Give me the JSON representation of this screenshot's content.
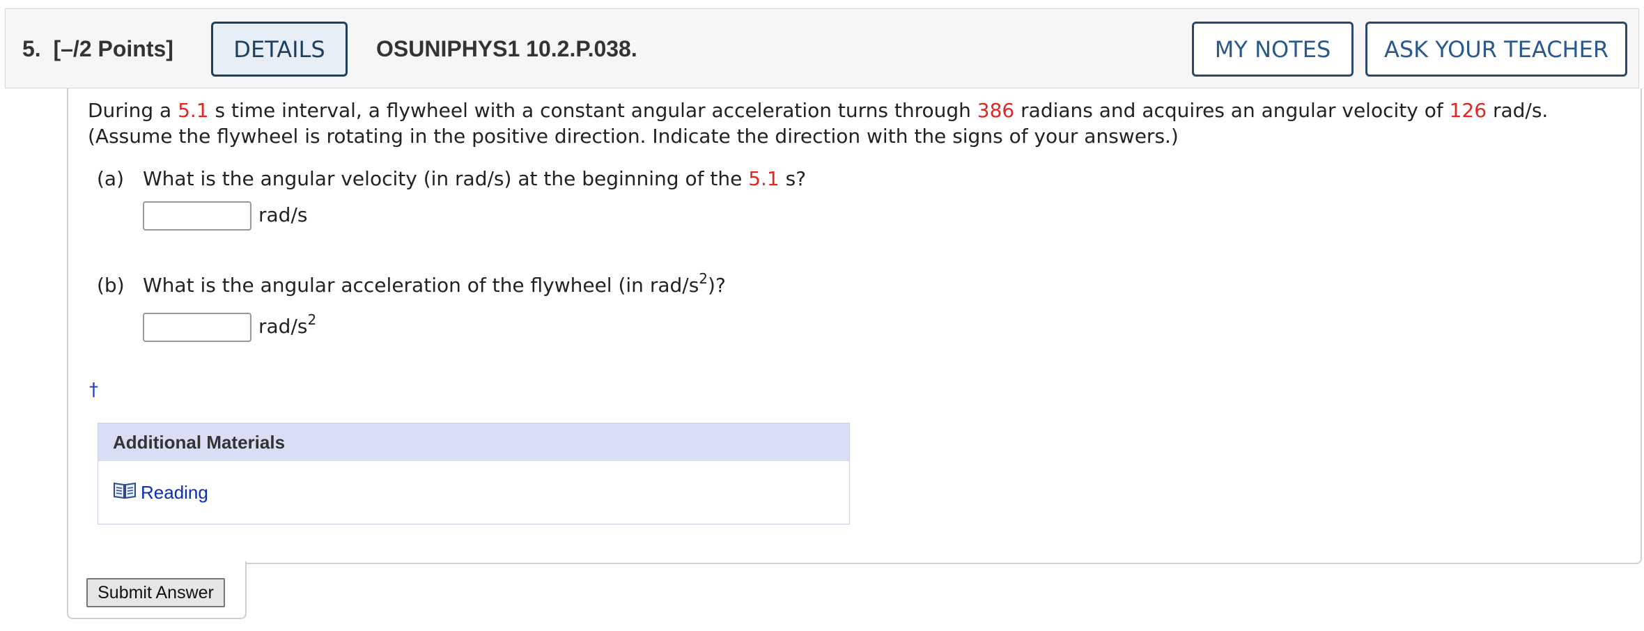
{
  "header": {
    "question_number": "5.",
    "points": "[–/2 Points]",
    "details_label": "DETAILS",
    "problem_code": "OSUNIPHYS1 10.2.P.038.",
    "my_notes_label": "MY NOTES",
    "ask_teacher_label": "ASK YOUR TEACHER"
  },
  "problem": {
    "t1": "During a ",
    "time": "5.1",
    "t2": " s time interval, a flywheel with a constant angular acceleration turns through ",
    "radians": "386",
    "t3": " radians and acquires an angular velocity of ",
    "velocity": "126",
    "t4": " rad/s. (Assume the flywheel is rotating in the positive direction. Indicate the direction with the signs of your answers.)"
  },
  "parts": {
    "a": {
      "label": "(a)",
      "q1": "What is the angular velocity (in rad/s) at the beginning of the ",
      "time": "5.1",
      "q2": " s?",
      "unit": "rad/s",
      "value": ""
    },
    "b": {
      "label": "(b)",
      "q1": "What is the angular acceleration of the flywheel (in rad/s",
      "q_sup": "2",
      "q2": ")?",
      "unit": "rad/s",
      "unit_sup": "2",
      "value": ""
    }
  },
  "dagger": "†",
  "additional_materials": {
    "title": "Additional Materials",
    "icon": "book-icon",
    "link_label": "Reading"
  },
  "submit_label": "Submit Answer",
  "colors": {
    "highlight_red": "#e0271f",
    "button_border": "#2a4a6b",
    "materials_header": "#d9def5",
    "link": "#0a2fb5"
  }
}
